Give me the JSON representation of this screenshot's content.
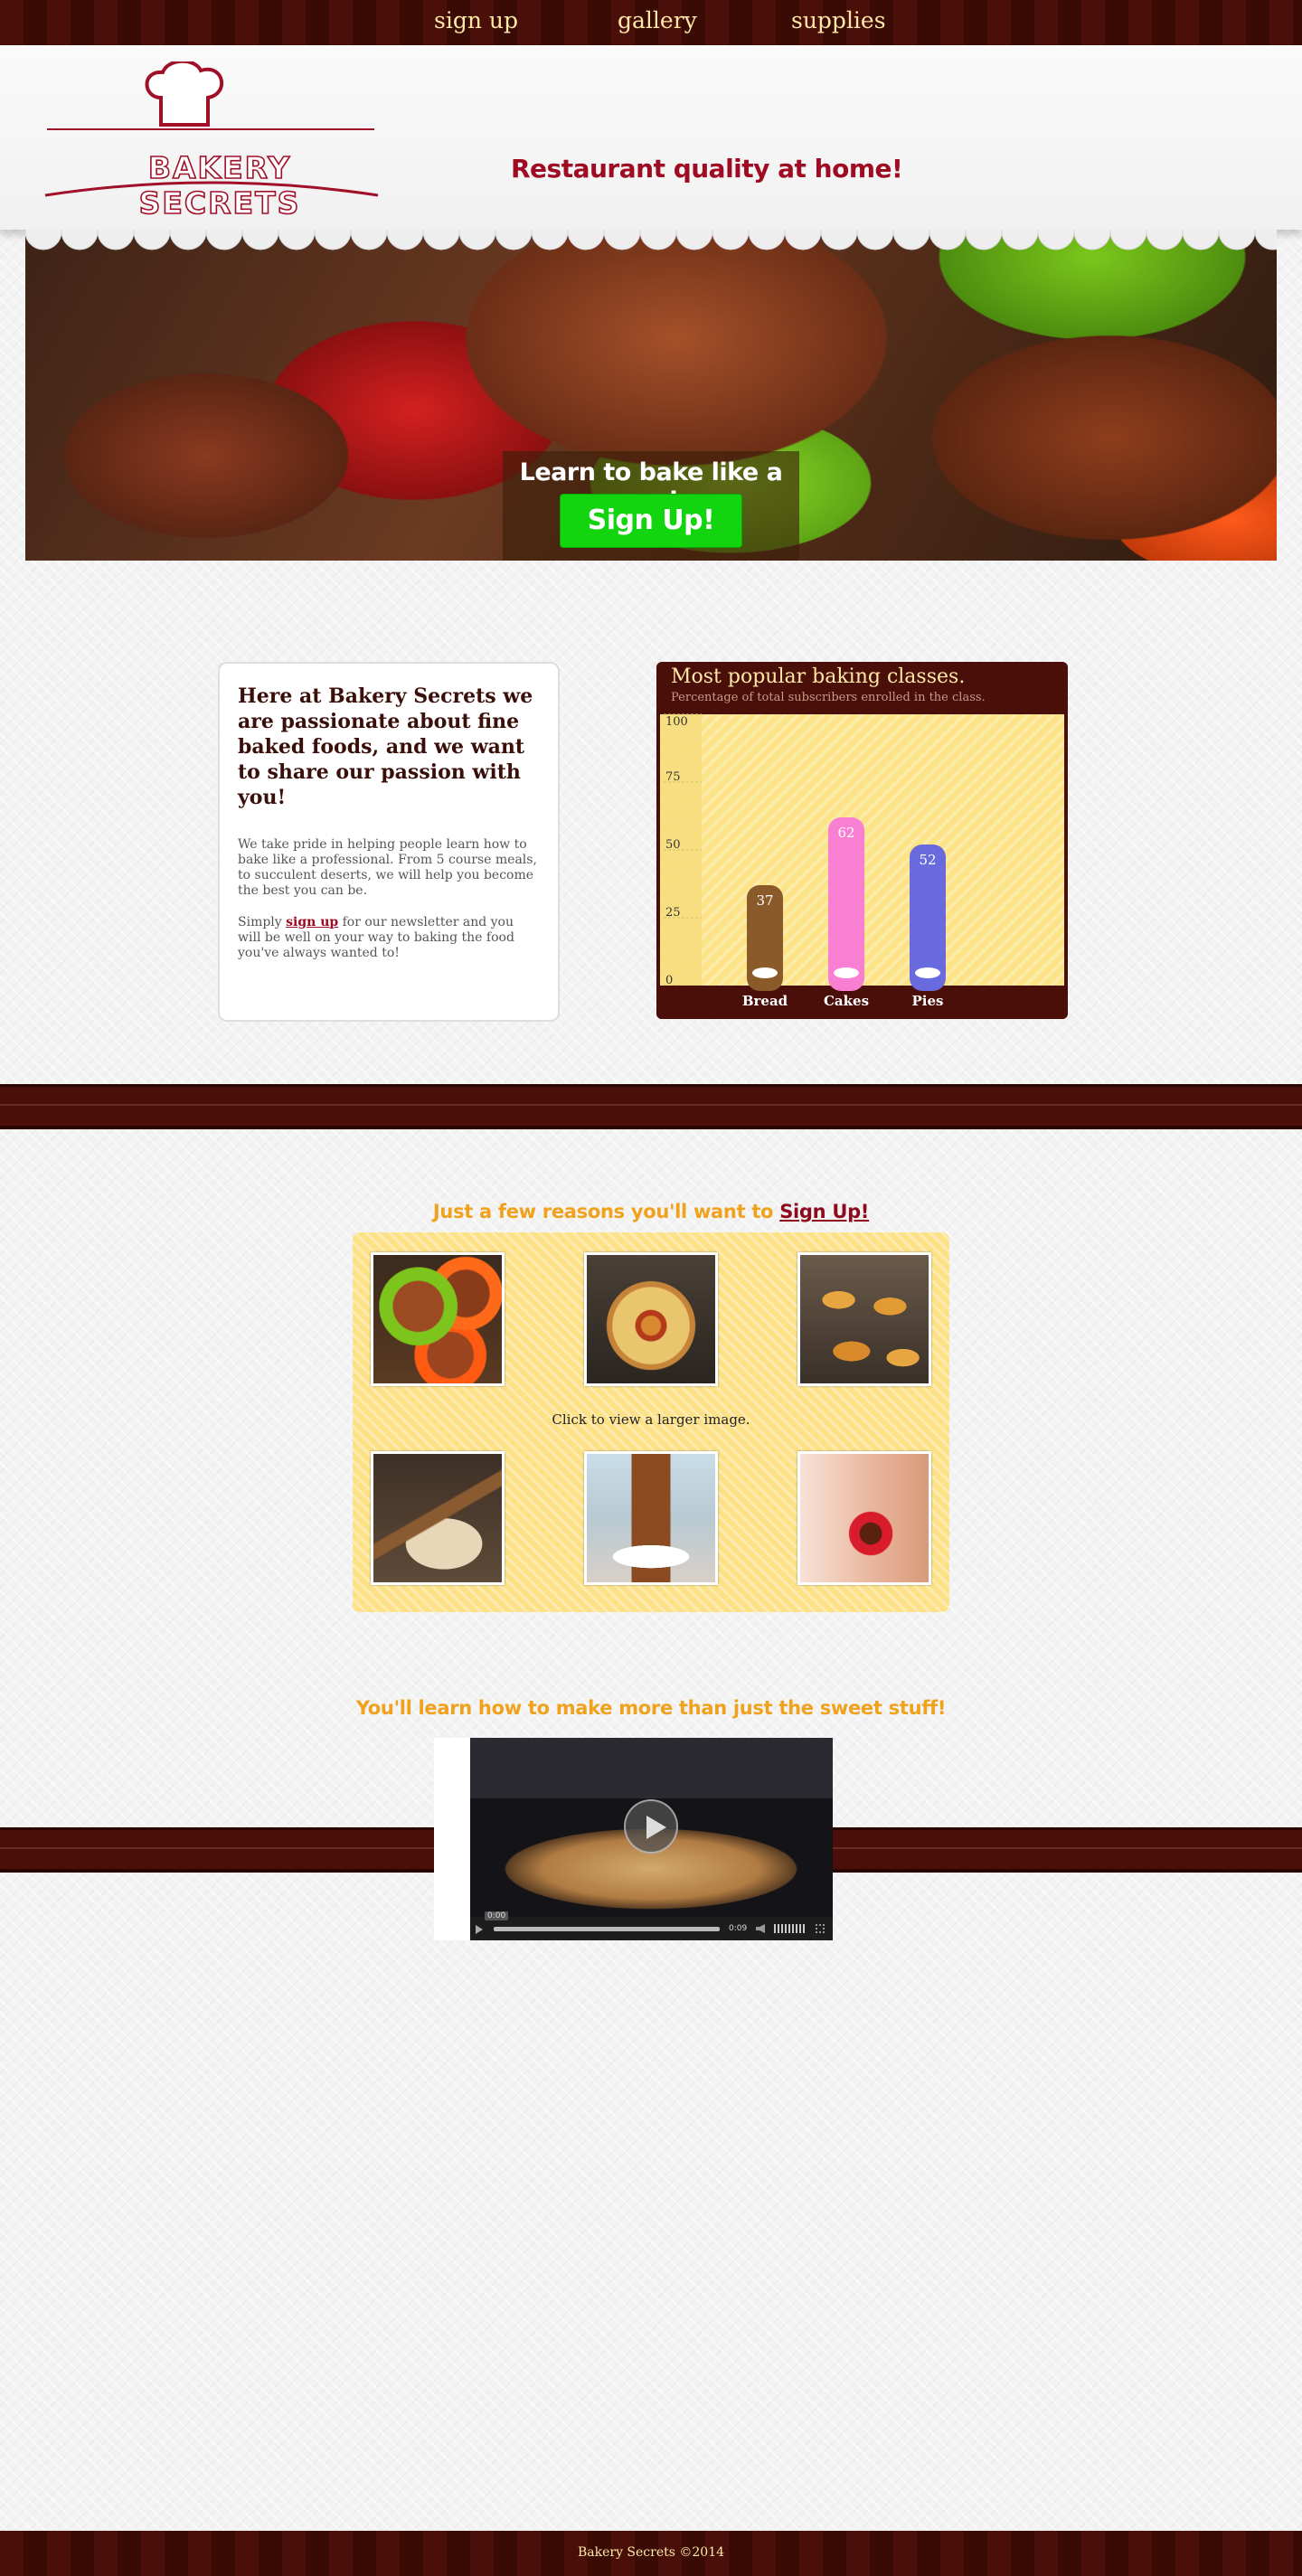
{
  "nav": {
    "items": [
      "sign up",
      "gallery",
      "supplies"
    ]
  },
  "header": {
    "logo_text": "BAKERY SECRETS",
    "tagline": "Restaurant quality at home!"
  },
  "hero": {
    "headline": "Learn to bake like a pro!",
    "button_label": "Sign Up!"
  },
  "intro": {
    "heading": "Here at Bakery Secrets we are passionate about fine baked foods, and we want to share our passion with you!",
    "paragraph1": "We take pride in helping people learn how to bake like a professional. From 5 course meals, to succulent deserts, we will help you become the best you can be.",
    "p2_before": "Simply ",
    "p2_link": "sign up",
    "p2_after": " for our newsletter and you will be well on your way to baking the food you've always wanted to!"
  },
  "chart_data": {
    "type": "bar",
    "title": "Most popular baking classes.",
    "subtitle": "Percentage of total subscribers enrolled in the class.",
    "categories": [
      "Bread",
      "Cakes",
      "Pies"
    ],
    "values": [
      37,
      62,
      52
    ],
    "colors": [
      "#8b5a2b",
      "#f97fd2",
      "#6a6adf"
    ],
    "yticks": [
      0,
      25,
      50,
      75,
      100
    ],
    "ylim": [
      0,
      100
    ],
    "legend": "none",
    "grid": false
  },
  "gallery": {
    "title_before": "Just a few reasons you'll want to ",
    "title_link": "Sign Up!",
    "caption": "Click to view a larger image.",
    "images": [
      "cupcakes-image",
      "pizza-image",
      "croissants-image",
      "rolling-pin-image",
      "cake-slice-image",
      "red-cupcake-image"
    ]
  },
  "video": {
    "title": "You'll learn how to make more than just the sweet stuff!",
    "time_current": "0:00",
    "time_total": "0:09"
  },
  "footer": {
    "text": "Bakery Secrets ©2014"
  },
  "colors": {
    "brand_red": "#9e0b22",
    "band_brown": "#4a0f08",
    "accent_orange": "#f0a21c",
    "cta_green": "#12d50f"
  }
}
